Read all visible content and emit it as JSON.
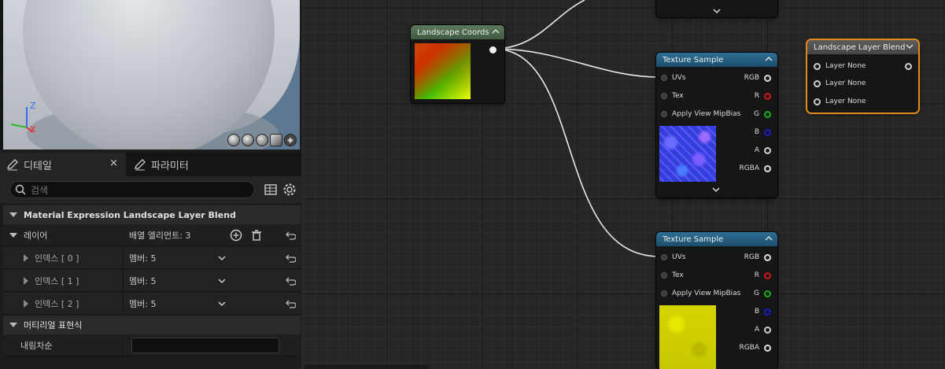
{
  "viewport": {
    "axis_z": "Z",
    "axis_x": "X"
  },
  "tabs": [
    {
      "label": "디테일",
      "active": true
    },
    {
      "label": "파라미터",
      "active": false
    }
  ],
  "tab_close": "×",
  "search": {
    "placeholder": "검색"
  },
  "details": {
    "section_title": "Material Expression Landscape Layer Blend",
    "layers": {
      "label": "레이어",
      "value": "배열 엘리먼트: 3",
      "items": [
        {
          "label": "인덱스 [ 0 ]",
          "value": "멤버: 5"
        },
        {
          "label": "인덱스 [ 1 ]",
          "value": "멤버: 5"
        },
        {
          "label": "인덱스 [ 2 ]",
          "value": "멤버: 5"
        }
      ]
    },
    "material_expression": {
      "label": "머티리얼 표현식",
      "desc_label": "내림차순",
      "desc_value": ""
    }
  },
  "graph": {
    "landscape_coords": {
      "title": "Landscape Coords"
    },
    "texture_sample_1": {
      "title": "Texture Sample",
      "inputs": [
        "UVs",
        "Tex",
        "Apply View MipBias"
      ],
      "outputs": [
        "RGB",
        "R",
        "G",
        "B",
        "A",
        "RGBA"
      ]
    },
    "texture_sample_2": {
      "title": "Texture Sample",
      "inputs": [
        "UVs",
        "Tex",
        "Apply View MipBias"
      ],
      "outputs": [
        "RGB",
        "R",
        "G",
        "B",
        "A",
        "RGBA"
      ]
    },
    "layer_blend": {
      "title": "Landscape Layer Blend",
      "inputs": [
        "Layer None",
        "Layer None",
        "Layer None"
      ],
      "accent_color": "#e08a1e"
    }
  },
  "colors": {
    "accent_selected": "#e08a1e",
    "pin_r": "#d01818",
    "pin_g": "#18b018",
    "pin_b": "#1a1ac8"
  }
}
